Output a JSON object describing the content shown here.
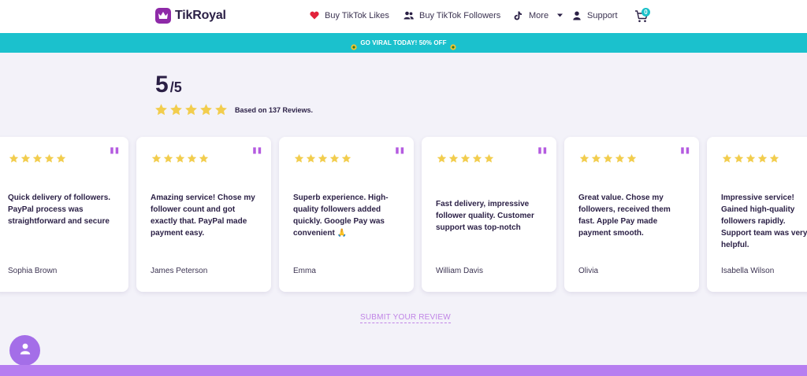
{
  "brand": {
    "name": "TikRoyal",
    "color": "#8e2aa8"
  },
  "nav": {
    "likes": {
      "label": "Buy TikTok Likes",
      "icon": "heart-icon"
    },
    "followers": {
      "label": "Buy TikTok Followers",
      "icon": "users-icon"
    },
    "more": {
      "label": "More",
      "icon": "tiktok-icon"
    },
    "support": {
      "label": "Support",
      "icon": "user-icon"
    },
    "cart": {
      "count": "0",
      "icon": "cart-icon"
    }
  },
  "promo": {
    "text": "GO VIRAL TODAY! 50% OFF",
    "color": "#1bc1cd"
  },
  "rating": {
    "score": "5",
    "out_of": "/5",
    "stars": 5,
    "summary": "Based on 137 Reviews."
  },
  "reviews": [
    {
      "text": "Quick delivery of followers. PayPal process was straightforward and secure",
      "author": "Sophia Brown",
      "stars": 5
    },
    {
      "text": "Amazing service! Chose my follower count and got exactly that. PayPal made payment easy.",
      "author": "James Peterson",
      "stars": 5
    },
    {
      "text": "Superb experience. High-quality followers added quickly. Google Pay was convenient 🙏",
      "author": "Emma",
      "stars": 5
    },
    {
      "text": "Fast delivery, impressive follower quality. Customer support was top-notch",
      "author": "William Davis",
      "stars": 5
    },
    {
      "text": "Great value. Chose my followers, received them fast. Apple Pay made payment smooth.",
      "author": "Olivia",
      "stars": 5
    },
    {
      "text": "Impressive service! Gained high-quality followers rapidly. Support team was very helpful.",
      "author": "Isabella Wilson",
      "stars": 5
    }
  ],
  "submit_review": "SUBMIT YOUR REVIEW",
  "colors": {
    "star": "#f2cd4e",
    "quote": "#b45be0",
    "accent": "#b67ef0"
  }
}
